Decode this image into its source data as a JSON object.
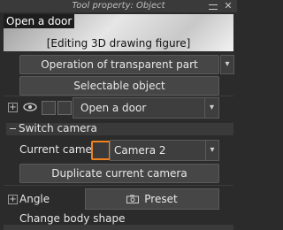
{
  "window": {
    "title": "Tool property: Object"
  },
  "preview": {
    "object_name": "Open a door",
    "status": "[Editing 3D drawing figure]"
  },
  "buttons": {
    "operation": "Operation of transparent part",
    "selectable": "Selectable object",
    "duplicate_camera": "Duplicate current camera",
    "preset": "Preset"
  },
  "layer": {
    "name": "Open a door"
  },
  "switch_camera": {
    "header": "Switch camera",
    "current_label": "Current camera",
    "current_value": "Camera 2"
  },
  "angle": {
    "label": "Angle"
  },
  "body_shape": {
    "label": "Change body shape"
  },
  "colors": {
    "accent": "#f0821e",
    "background": "#2b2b2b"
  }
}
